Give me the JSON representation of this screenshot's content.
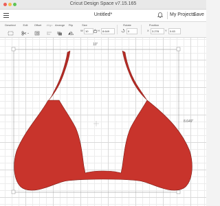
{
  "window": {
    "title": "Cricut Design Space  v7.15.165"
  },
  "header": {
    "document_title": "Untitled*",
    "my_projects_label": "My Projects",
    "save_label": "Save"
  },
  "toolbar": {
    "deselect_label": "Deselect",
    "edit_label": "Edit",
    "offset_label": "Offset",
    "align_label": "Align",
    "arrange_label": "Arrange",
    "flip_label": "Flip",
    "size_label": "Size",
    "rotate_label": "Rotate",
    "position_label": "Position",
    "size_w_prefix": "W",
    "size_w_value": "10",
    "size_h_prefix": "H",
    "size_h_value": "8.649",
    "rotate_value": "0",
    "position_x_prefix": "X",
    "position_x_value": "3.278",
    "position_y_prefix": "Y",
    "position_y_value": "0.63"
  },
  "canvas": {
    "width_label": "10\"",
    "height_label": "8.649\"",
    "shape_color": "#c8342c",
    "shape_stroke": "#7a1c17"
  },
  "colors": {
    "close": "#ec5f57",
    "minimize": "#f5bf4f",
    "maximize": "#5fc454"
  }
}
